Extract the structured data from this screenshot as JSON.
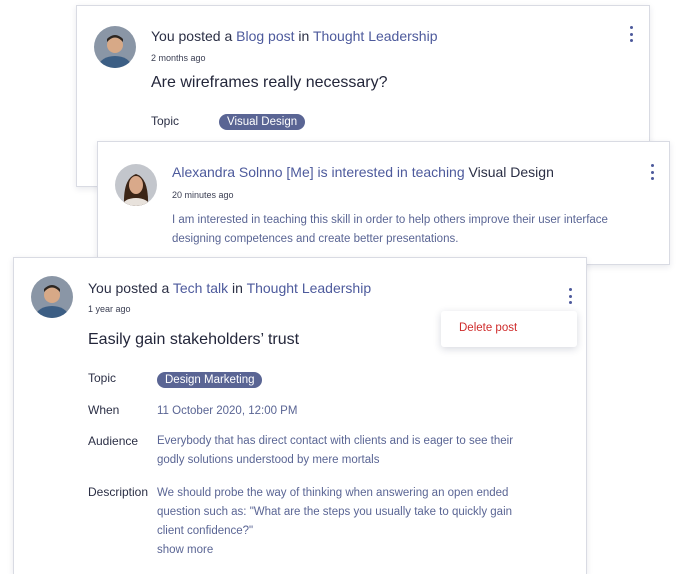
{
  "posts": [
    {
      "author": "You",
      "verb": "posted a",
      "type": "Blog post",
      "in_word": "in",
      "group": "Thought Leadership",
      "time": "2 months ago",
      "title": "Are wireframes really necessary?",
      "topic_label": "Topic",
      "topic": "Visual Design"
    },
    {
      "author": "Alexandra Solnno [Me]",
      "verb": "is interested in teaching",
      "subject": "Visual Design",
      "time": "20 minutes ago",
      "body_line1": "I am interested in teaching this skill in order to help others improve their user interface",
      "body_line2": "designing competences and create better presentations."
    },
    {
      "author": "You",
      "verb": "posted a",
      "type": "Tech talk",
      "in_word": "in",
      "group": "Thought Leadership",
      "time": "1 year ago",
      "title": "Easily gain stakeholders’ trust",
      "topic_label": "Topic",
      "topic": "Design Marketing",
      "when_label": "When",
      "when": "11 October 2020, 12:00 PM",
      "audience_label": "Audience",
      "audience_line1": "Everybody that has direct contact with clients and is eager to see their",
      "audience_line2": "godly solutions understood by mere mortals",
      "description_label": "Description",
      "description_line1": "We should probe the way of thinking when answering an open ended",
      "description_line2": "question such as: \"What are the steps you usually take to quickly gain",
      "description_line3": "client confidence?\"",
      "show_more": "show more"
    }
  ],
  "context_menu": {
    "delete_label": "Delete post"
  },
  "icons": [
    "avatar-man",
    "avatar-woman",
    "kebab-menu-icon"
  ],
  "colors": {
    "link": "#4d5a9c",
    "tag_bg": "#5a6594",
    "danger": "#cf2b2b"
  }
}
